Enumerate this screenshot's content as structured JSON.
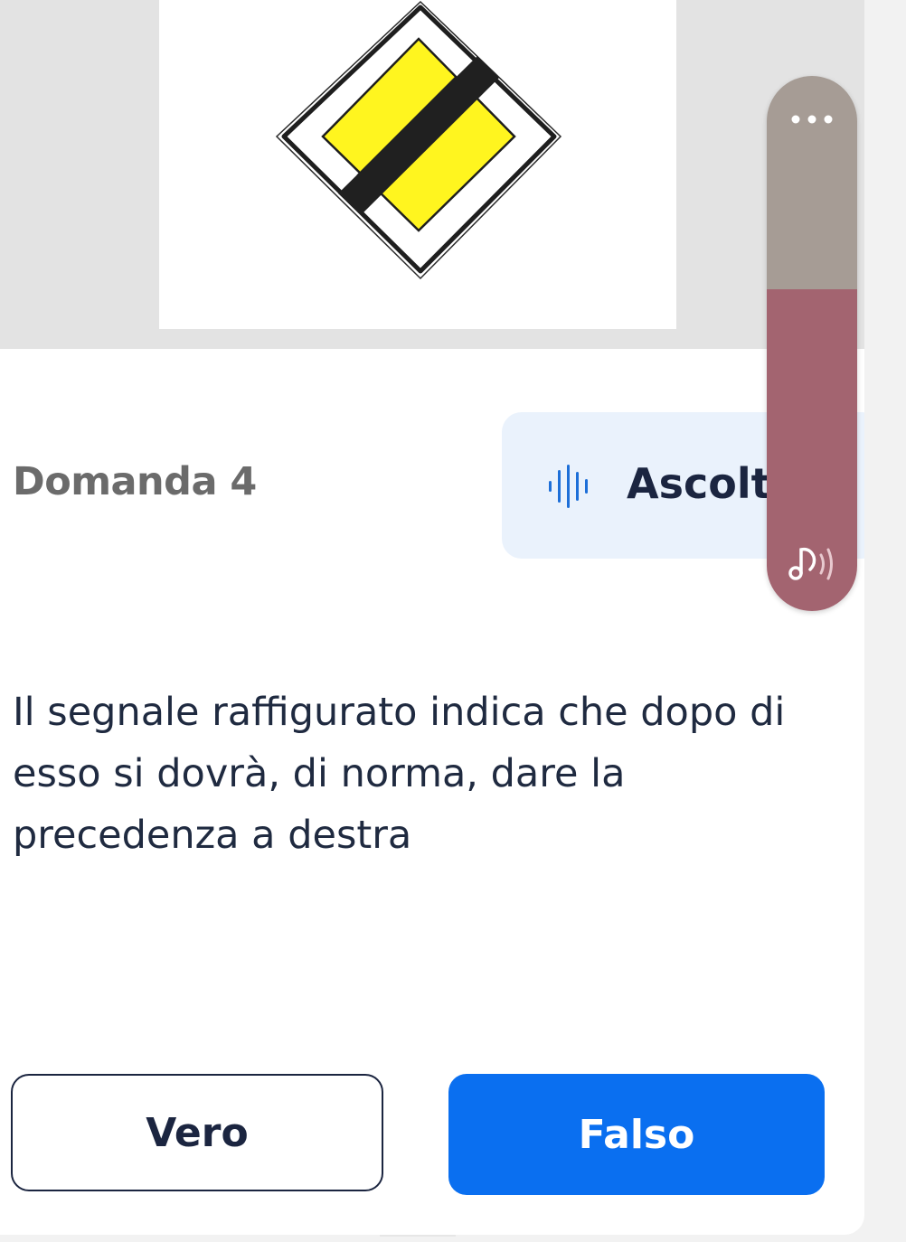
{
  "sign": {
    "description_icon": "priority-road-end-sign-icon",
    "colors": {
      "yellow": "#fff51f",
      "bar": "#202020",
      "border": "#2a2a2a"
    }
  },
  "question": {
    "label": "Domanda 4",
    "text": "Il segnale raffigurato indica che dopo di esso si dovrà, di norma, dare la precedenza a destra"
  },
  "listen": {
    "label": "Ascolto",
    "icon": "sound-wave-icon",
    "accent": "#1d6fd8"
  },
  "answers": {
    "true_label": "Vero",
    "false_label": "Falso",
    "selected": "Falso",
    "selected_color": "#0a6ff0"
  },
  "float_widget": {
    "more_icon": "more-dots-icon",
    "music_icon": "music-sound-icon",
    "top_color": "#a69c95",
    "bottom_color": "#a36470"
  }
}
